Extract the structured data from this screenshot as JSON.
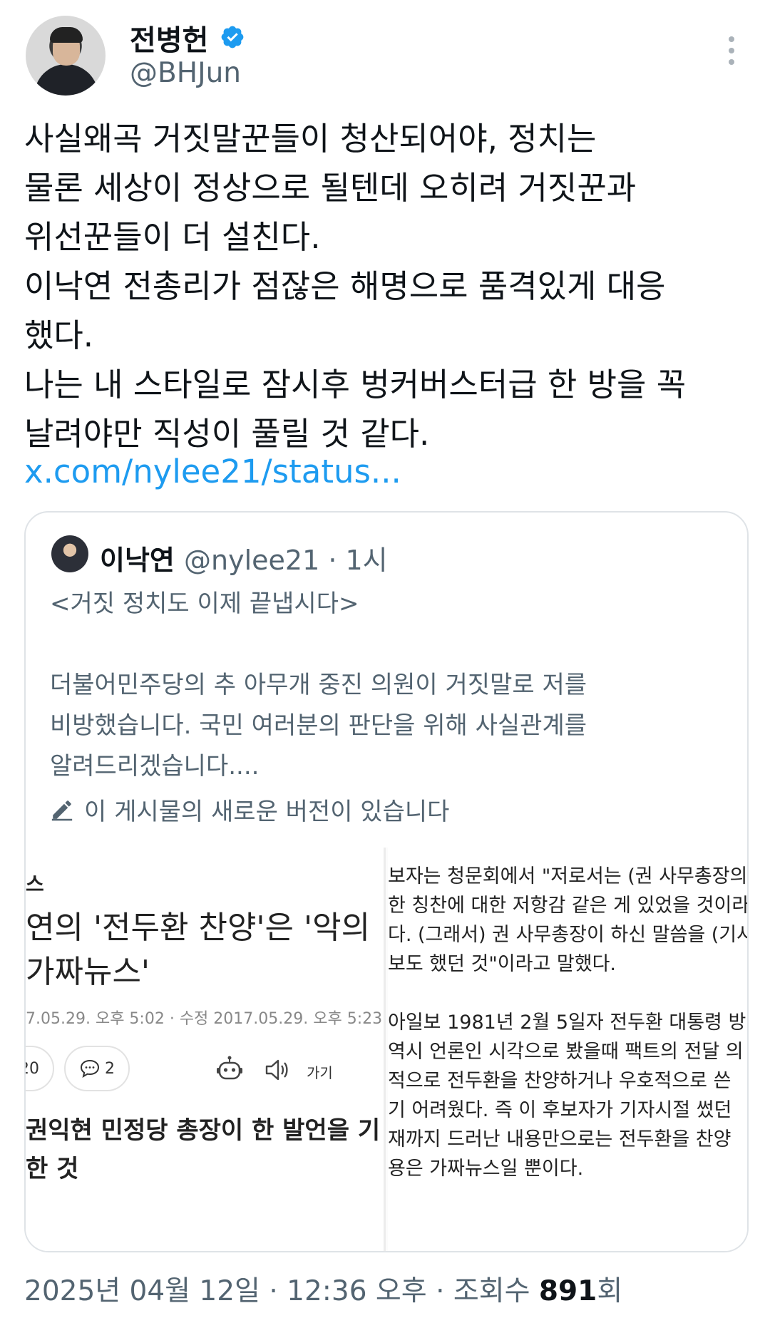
{
  "author": {
    "name": "전병헌",
    "handle": "@BHJun",
    "verified_color": "#1d9bf0"
  },
  "tweet": {
    "text": "사실왜곡 거짓말꾼들이 청산되어야, 정치는\n물론 세상이 정상으로 될텐데 오히려 거짓꾼과\n위선꾼들이 더 설친다.\n이낙연 전총리가 점잖은 해명으로 품격있게 대응\n했다.\n나는 내 스타일로 잠시후 벙커버스터급 한 방을 꼭\n날려야만 직성이 풀릴 것 같다.",
    "link": "x.com/nylee21/status..."
  },
  "quote": {
    "name": "이낙연",
    "meta": "@nylee21 · 1시",
    "text": "<거짓 정치도 이제 끝냅시다>\n\n더불어민주당의 추 아무개 중진 의원이 거짓말로 저를\n비방했습니다. 국민 여러분의 판단을 위해 사실관계를\n알려드리겠습니다....",
    "edit_notice": "이 게시물의 새로운 버전이 있습니다",
    "media": {
      "left": {
        "category": "스",
        "headline": "연의 '전두환 찬양'은 '악의\n가짜뉴스'",
        "date": "7.05.29. 오후 5:02 · 수정 2017.05.29. 오후 5:23",
        "like_count": "20",
        "comment_count": "2",
        "ga_label": "가기",
        "subheadline": "권익현 민정당 총장이 한 발언을 기\n한 것"
      },
      "right": {
        "text": "보자는 청문회에서 \"저로서는 (권 사무총장의\n한 칭찬에 대한 저항감 같은 게 있었을 것이라\n다. (그래서) 권 사무총장이 하신 말씀을 (기사\n보도 했던 것\"이라고 말했다.\n\n아일보 1981년 2월 5일자 전두환 대통령 방\n역시 언론인 시각으로 봤을때 팩트의 전달 의\n적으로 전두환을 찬양하거나 우호적으로 쓴\n기 어려웠다. 즉 이 후보자가 기자시절 썼던\n재까지 드러난 내용만으로는 전두환을 찬양\n용은 가짜뉴스일 뿐이다."
      }
    }
  },
  "footer": {
    "datetime": "2025년 04월 12일 · 12:36 오후 · 조회수 ",
    "views": "891",
    "views_suffix": "회"
  }
}
